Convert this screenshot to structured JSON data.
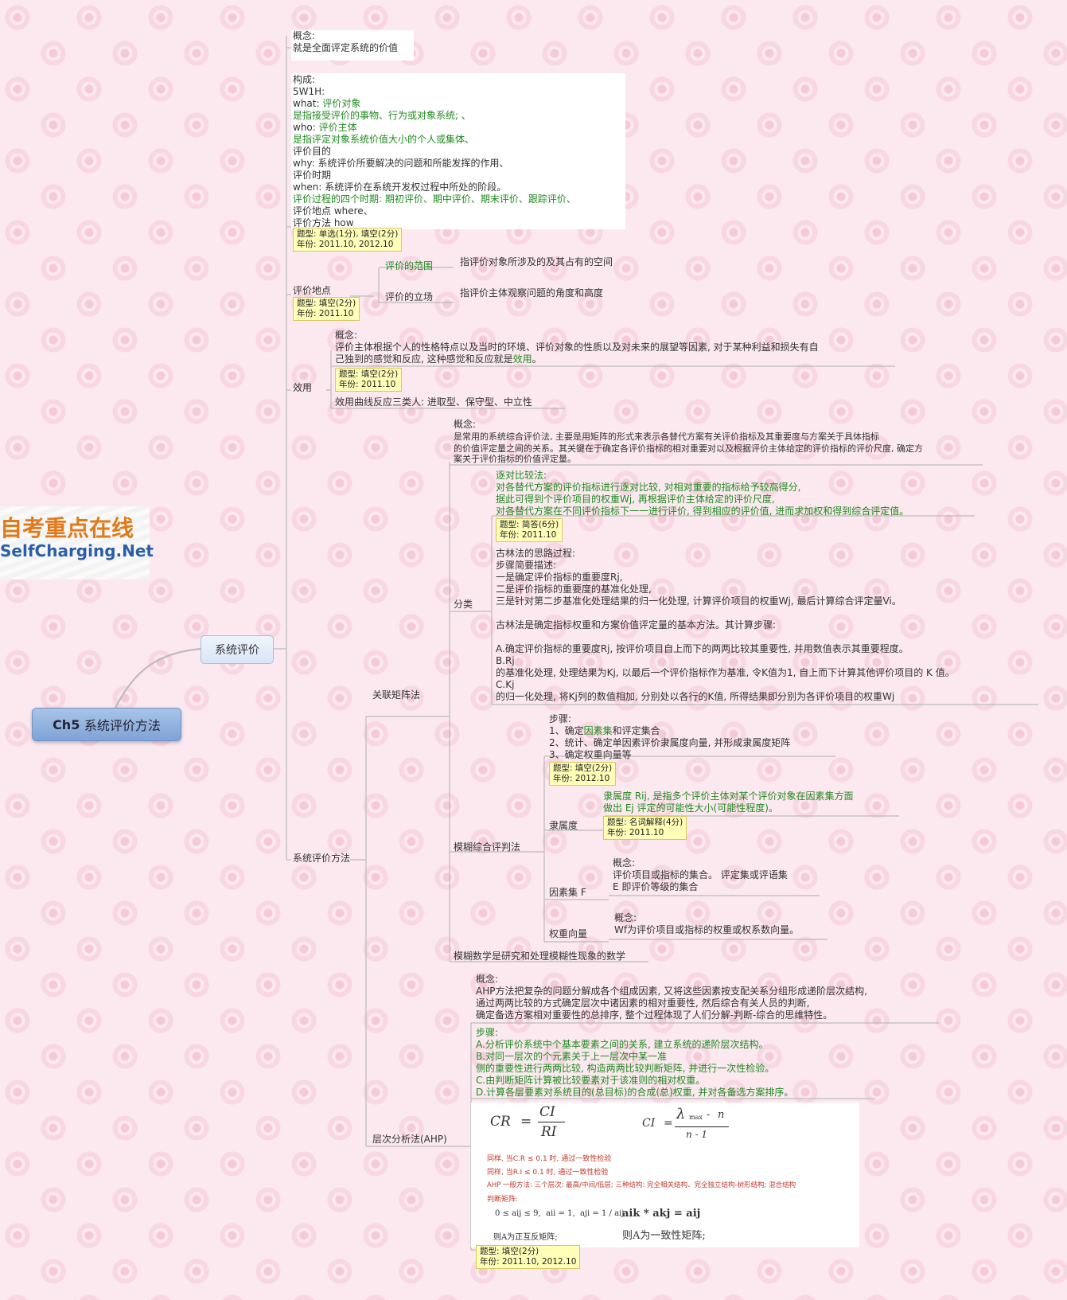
{
  "root": {
    "label": "Ch5",
    "title": "系统评价方法"
  },
  "main_topic": "系统评价",
  "logo": {
    "cn": "自考重点在线",
    "en": "SelfCharging.Net"
  },
  "concept": {
    "label": "概念:",
    "text": "就是全面评定系统的价值"
  },
  "composition": {
    "lines": [
      {
        "a": "构成:",
        "b": ""
      },
      {
        "a": "5W1H:",
        "b": ""
      },
      {
        "a": "what: ",
        "b": "评价对象"
      },
      {
        "a": "",
        "b": "是指接受评价的事物、行为或对象系统; 、"
      },
      {
        "a": "who: ",
        "b": "评价主体"
      },
      {
        "a": "",
        "b": "是指评定对象系统价值大小的个人或集体、"
      },
      {
        "a": "评价目的",
        "b": ""
      },
      {
        "a": "why: 系统评价所要解决的问题和所能发挥的作用、",
        "b": ""
      },
      {
        "a": "评价时期",
        "b": ""
      },
      {
        "a": "when: 系统评价在系统开发权过程中所处的阶段。",
        "b": ""
      },
      {
        "a": "",
        "b": "评价过程的四个时期: 期初评价、期中评价、期末评价、跟踪评价、"
      },
      {
        "a": "评价地点 where、",
        "b": ""
      },
      {
        "a": "评价方法 how",
        "b": ""
      }
    ],
    "note": [
      "题型: 单选(1分), 填空(2分)",
      "年份: 2011.10, 2012.10"
    ]
  },
  "place": {
    "label": "评价地点",
    "note": [
      "题型: 填空(2分)",
      "年份: 2011.10"
    ],
    "range_label": "评价的范围",
    "range_text": "指评价对象所涉及的及其占有的空间",
    "stand_label": "评价的立场",
    "stand_text": "指评价主体观察问题的角度和高度"
  },
  "utility": {
    "label": "效用",
    "concept_label": "概念:",
    "concept_lines": [
      "评价主体根据个人的性格特点以及当时的环境、评价对象的性质以及对未来的展望等因素, 对于某种利益和损失有自",
      "己独到的感觉和反应, 这种感觉和反应就是"
    ],
    "concept_hl": "效用",
    "concept_end": "。",
    "note": [
      "题型: 填空(2分)",
      "年份: 2011.10"
    ],
    "curve": "效用曲线反应三类人: 进取型、保守型、中立性"
  },
  "methods_label": "系统评价方法",
  "matrix": {
    "label": "关联矩阵法",
    "concept_label": "概念:",
    "concept_lines": [
      "是常用的系统综合评价法, 主要是用矩阵的形式来表示各替代方案有关评价指标及其重要度与方案关于具体指标",
      "的价值评定量之间的关系。其关键在于确定各评价指标的相对重要对以及根据评价主体给定的评价指标的评价尺度, 确定方",
      "案关于评价指标的价值评定量。"
    ],
    "class_label": "分类",
    "pairwise_lines": [
      "逐对比较法:",
      "对各替代方案的评价指标进行逐对比较, 对相对重要的指标给予较高得分,",
      "据此可得到个评价项目的权重Wj, 再根据评价主体给定的评价尺度,",
      "对各替代方案在不同评价指标下一一进行评价, 得到相应的评价值, 进而求加权和得到综合评定值。"
    ],
    "note": [
      "题型: 简答(6分)",
      "年份: 2011.10"
    ],
    "gulin_lines": [
      "古林法的思路过程:",
      "步骤简要描述:",
      "一是确定评价指标的重要度Rj,",
      "二是评价指标的重要度的基准化处理,",
      "三是针对第二步基准化处理结果的归一化处理, 计算评价项目的权重Wj, 最后计算综合评定量Vi。",
      "",
      "古林法是确定指标权重和方案价值评定量的基本方法。其计算步骤:",
      "",
      "A.确定评价指标的重要度Rj, 按评价项目自上而下的两两比较其重要性, 并用数值表示其重要程度。",
      "B.Rj",
      "的基准化处理, 处理结果为Kj, 以最后一个评价指标作为基准, 令K值为1, 自上而下计算其他评价项目的 K 值。",
      "C.Kj",
      "的归一化处理, 将Kj列的数值相加, 分别处以各行的K值, 所得结果即分别为各评价项目的权重Wj"
    ]
  },
  "fuzzy": {
    "label": "模糊综合评判法",
    "steps_lines": [
      "步骤:",
      "1、确定",
      "2、统计、确定单因素评价隶属度向量, 并形成隶属度矩阵",
      "3、确定权重向量等"
    ],
    "steps_hl": "因素集",
    "steps_tail": "和评定集合",
    "note": [
      "题型: 填空(2分)",
      "年份: 2012.10"
    ],
    "membership_label": "隶属度",
    "membership_lines": [
      "隶属度 Rij, 是指多个评价主体对某个评价对象在因素集方面",
      "做出 Ej 评定的可能性大小(可能性程度)。"
    ],
    "membership_note": [
      "题型: 名词解释(4分)",
      "年份: 2011.10"
    ],
    "factor_label": "因素集 F",
    "factor_lines": [
      "概念:",
      "评价项目或指标的集合。 评定集或评语集",
      "E 即评价等级的集合"
    ],
    "weight_label": "权重向量",
    "weight_lines": [
      "概念:",
      "Wf为评价项目或指标的权重或权系数向量。"
    ],
    "math": "模糊数学是研究和处理模糊性现象的数学"
  },
  "ahp": {
    "label": "层次分析法(AHP)",
    "concept_lines": [
      "概念:",
      "AHP方法把复杂的问题分解成各个组成因素, 又将这些因素按支配关系分组形成递阶层次结构,",
      "通过两两比较的方式确定层次中诸因素的相对重要性, 然后综合有关人员的判断,",
      "确定备选方案相对重要性的总排序, 整个过程体现了人们分解-判断-综合的思维特性。"
    ],
    "steps_lines": [
      "步骤:",
      "A.分析评价系统中个基本要素之间的关系, 建立系统的递阶层次结构。",
      "B.对同一层次的个元素关于上一层次中某一准",
      "侧的重要性进行两两比较, 构造两两比较判断矩阵, 并进行一次性检验。",
      "C.由判断矩阵计算被比较要素对于该准则的相对权重。",
      "D.计算各层要素对系统目的(总目标)的合成(总)权重, 并对各备选方案排序。"
    ],
    "formula": {
      "cr": "CR",
      "ci": "CI",
      "ri": "RI",
      "lambda": "λ",
      "max": "max",
      "n": "n",
      "n_minus_1": "n - 1",
      "check1": "同样, 当C.R ≤ 0.1 时, 通过一致性检验",
      "check2": "同样, 当R.I ≤ 0.1 时, 通过一致性检验",
      "general": "AHP 一般方法: 三个层次: 最高/中间/低层; 三种结构: 完全相关结构、完全独立结构-树形结构; 混合结构",
      "judge": "判断矩阵:",
      "cond": "0 ≤ aij ≤ 9,  aii = 1,  aji = 1 / aij",
      "recip": "则A为正互反矩阵;",
      "prod": "aik * akj = aij",
      "consistent": "则A为一致性矩阵;"
    },
    "note": [
      "题型: 填空(2分)",
      "年份: 2011.10, 2012.10"
    ]
  }
}
